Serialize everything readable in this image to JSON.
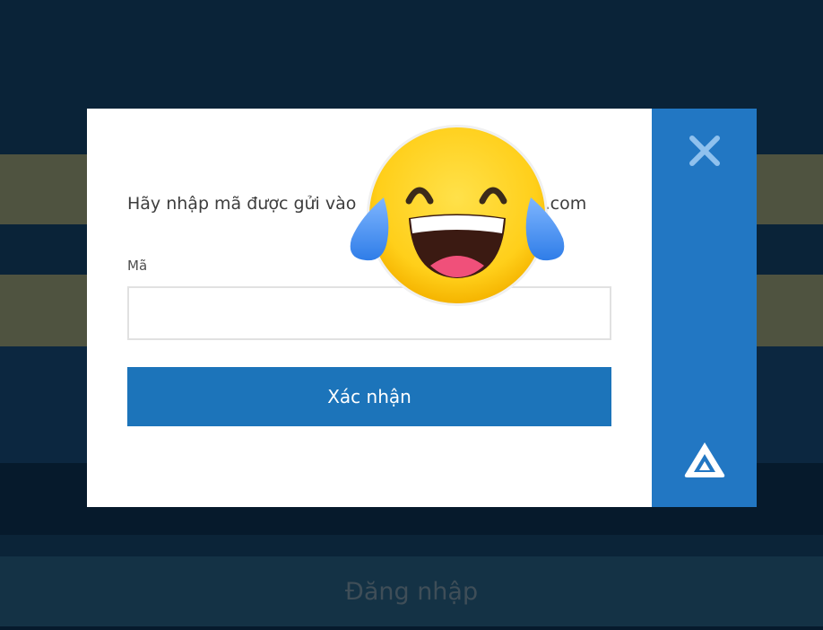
{
  "background": {
    "login_label": "Đăng nhập"
  },
  "dialog": {
    "message_start": "Hãy nhập mã được gửi vào",
    "message_end": "ail.com",
    "field_label": "Mã",
    "code_value": "",
    "confirm_label": "Xác nhận",
    "close_icon": "close-x-icon",
    "logo_icon": "triangle-logo-icon"
  },
  "colors": {
    "page_bg": "#0a2338",
    "band": "#4f5340",
    "side_panel": "#2277c3",
    "confirm_button": "#1c74ba",
    "close_icon": "#8fc1ee"
  },
  "overlay": {
    "emoji": "tears-of-joy-emoji"
  }
}
